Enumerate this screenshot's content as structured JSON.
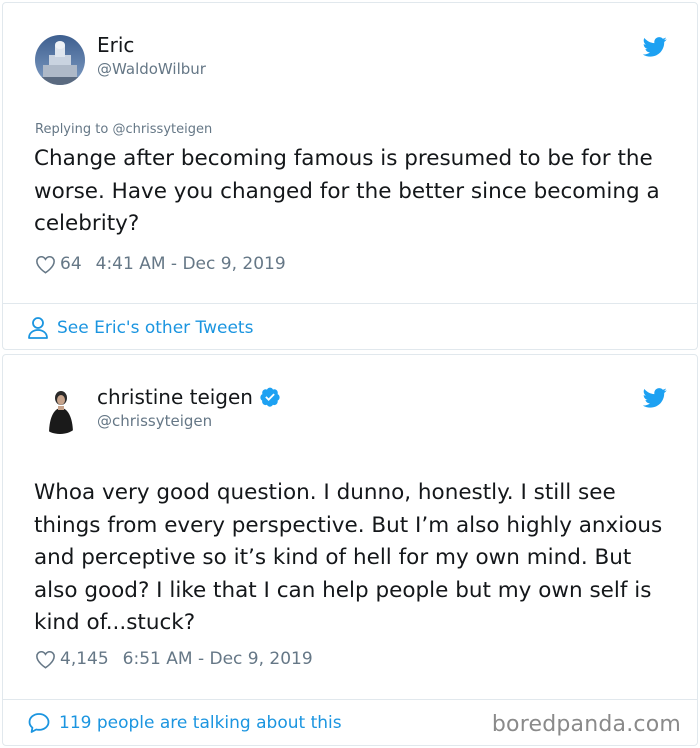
{
  "tweets": [
    {
      "author_name": "Eric",
      "author_handle": "@WaldoWilbur",
      "replying_to_prefix": "Replying to",
      "replying_to_handle": "@chrissyteigen",
      "text": "Change after becoming famous is presumed to be for the worse. Have you changed for the better since becoming a celebrity?",
      "likes": "64",
      "timestamp": "4:41 AM - Dec 9, 2019",
      "footer_link": "See Eric's other Tweets",
      "footer_icon": "person-icon"
    },
    {
      "author_name": "christine teigen",
      "author_handle": "@chrissyteigen",
      "verified": true,
      "text": "Whoa very good question. I dunno, honestly. I still see things from every perspective. But I’m also highly anxious and perceptive so it’s kind of hell for my own mind. But also good? I like that I can help people but my own self is kind of...stuck?",
      "likes": "4,145",
      "timestamp": "6:51 AM - Dec 9, 2019",
      "footer_link": "119 people are talking about this",
      "footer_icon": "speech-bubble-icon"
    }
  ],
  "watermark": "boredpanda.com",
  "colors": {
    "twitter_blue": "#1da1f2",
    "link_blue": "#1b95e0",
    "text": "#14171a",
    "muted": "#657786",
    "border": "#e1e8ed"
  }
}
